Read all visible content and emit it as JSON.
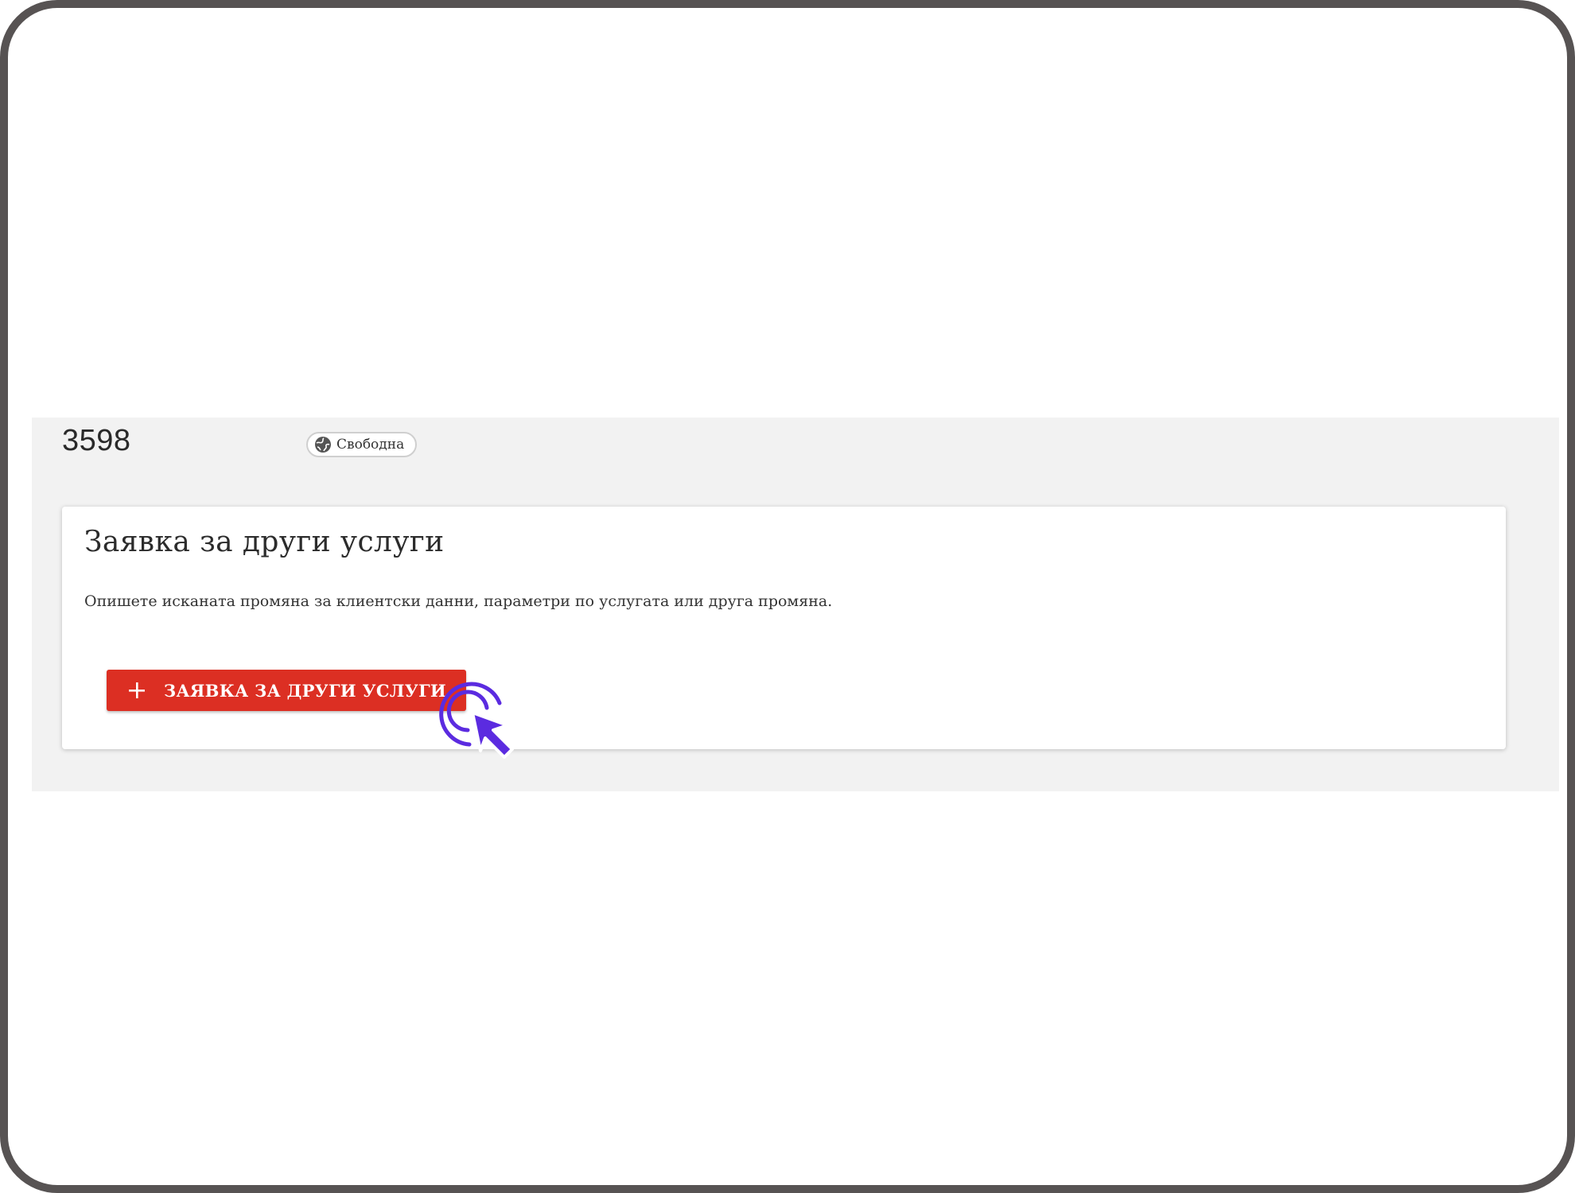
{
  "header": {
    "number": "3598",
    "status_badge": {
      "icon": "globe-icon",
      "label": "Свободна"
    }
  },
  "card": {
    "title": "Заявка за други услуги",
    "description": "Опишете исканата промяна за клиентски данни, параметри по услугата или друга промяна.",
    "button": {
      "icon": "plus-icon",
      "label": "ЗАЯВКА ЗА ДРУГИ УСЛУГИ"
    }
  },
  "overlay": {
    "pointer_icon": "click-pointer-icon"
  },
  "colors": {
    "frame_border": "#575353",
    "panel_background": "#f2f2f2",
    "button_background": "#dc2f23",
    "pointer_accent": "#5b2be0"
  }
}
